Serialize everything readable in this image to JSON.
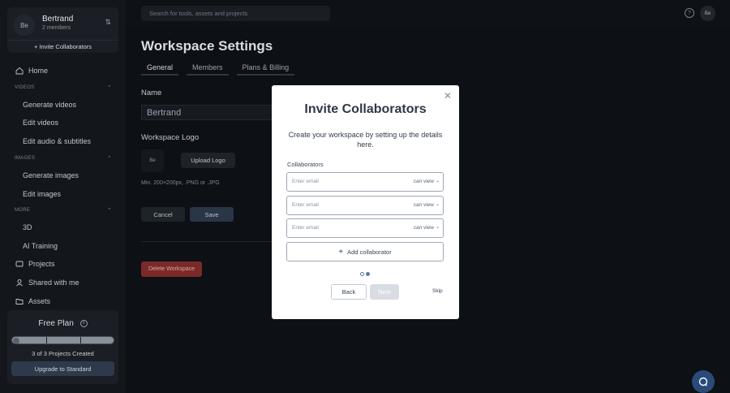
{
  "workspace": {
    "logo_text": "Be",
    "name": "Bertrand",
    "members": "2 members",
    "switch_icon": "chevron-updown-icon",
    "invite": "+ Invite Collaborators"
  },
  "nav": {
    "home": "Home",
    "videos_section": "VIDEOS",
    "generate_videos": "Generate videos",
    "edit_videos": "Edit videos",
    "edit_audio": "Edit audio & subtitles",
    "images_section": "IMAGES",
    "generate_images": "Generate images",
    "edit_images": "Edit images",
    "more_section": "MORE",
    "three_d": "3D",
    "ai_training": "AI Training",
    "projects": "Projects",
    "shared": "Shared with me",
    "assets": "Assets"
  },
  "plan": {
    "title": "Free Plan",
    "usage": "3 of 3 Projects Created",
    "usage_fraction": 1.0,
    "upgrade": "Upgrade to Standard"
  },
  "search": {
    "placeholder": "Search for tools, assets and projects"
  },
  "top": {
    "help": "?",
    "avatar": "Be"
  },
  "page": {
    "title": "Workspace Settings",
    "tabs": [
      "General",
      "Members",
      "Plans & Billing"
    ],
    "name_label": "Name",
    "name_value": "Bertrand",
    "logo_label": "Workspace Logo",
    "logo_placeholder": "Be",
    "upload_logo": "Upload Logo",
    "logo_hint": "Min. 200×200px, .PNG or .JPG",
    "cancel": "Cancel",
    "save": "Save",
    "delete": "Delete Workspace"
  },
  "modal": {
    "title": "Invite Collaborators",
    "description": "Create your workspace by setting up the details here.",
    "collaborators_label": "Collaborators",
    "rows": [
      {
        "placeholder": "Enter email",
        "permission": "can view"
      },
      {
        "placeholder": "Enter email",
        "permission": "can view"
      },
      {
        "placeholder": "Enter email",
        "permission": "can view"
      }
    ],
    "add_collaborator": "Add collaborator",
    "back": "Back",
    "next": "Next",
    "skip": "Skip",
    "close_icon": "close-icon"
  }
}
